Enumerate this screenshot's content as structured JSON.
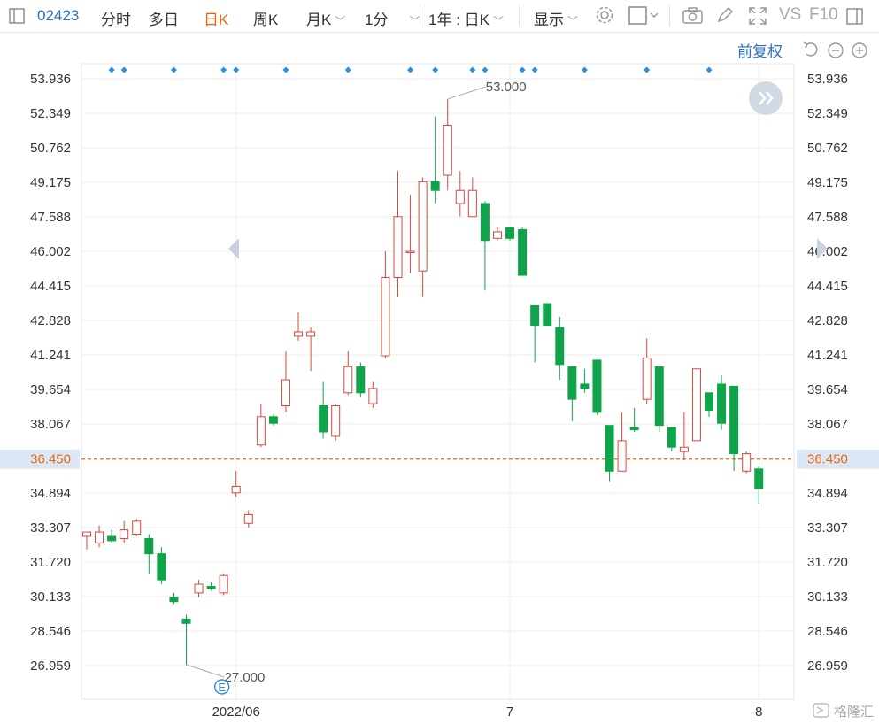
{
  "toolbar": {
    "symbol": "02423",
    "tabs": [
      "分时",
      "多日",
      "日K",
      "周K",
      "月K",
      "1分"
    ],
    "active_tab": "日K",
    "range_select": "1年 : 日K",
    "display_label": "显示",
    "vs_label": "VS",
    "f10_label": "F10"
  },
  "subbar": {
    "adjust_label": "前复权"
  },
  "watermark": "格隆汇",
  "colors": {
    "up": "#d9473c",
    "down": "#0fa44a",
    "accent": "#2a6fc0",
    "active_tab": "#e8670d",
    "current_price": "#e8670d"
  },
  "chart_data": {
    "type": "candlestick",
    "yticks": [
      53.936,
      52.349,
      50.762,
      49.175,
      47.588,
      46.002,
      44.415,
      42.828,
      41.241,
      39.654,
      38.067,
      36.45,
      34.894,
      33.307,
      31.72,
      30.133,
      28.546,
      26.959
    ],
    "ylim": [
      25.9,
      55.6
    ],
    "current_price": 36.45,
    "x_labels": [
      {
        "label": "2022/06",
        "index": 12
      },
      {
        "label": "7",
        "index": 34
      },
      {
        "label": "8",
        "index": 54
      }
    ],
    "annotations": [
      {
        "text": "53.000",
        "index": 29,
        "value": 53.0
      },
      {
        "text": "27.000",
        "index": 8,
        "value": 27.0
      }
    ],
    "event_marker": {
      "text": "E",
      "index": 11
    },
    "dividend_marks": [
      2,
      3,
      7,
      11,
      12,
      16,
      21,
      26,
      28,
      31,
      32,
      35,
      36,
      40,
      45,
      50
    ],
    "candles": [
      {
        "o": 32.9,
        "h": 33.1,
        "l": 32.3,
        "c": 33.1
      },
      {
        "o": 32.6,
        "h": 33.4,
        "l": 32.4,
        "c": 33.1
      },
      {
        "o": 32.9,
        "h": 33.2,
        "l": 32.6,
        "c": 32.7
      },
      {
        "o": 32.8,
        "h": 33.6,
        "l": 32.6,
        "c": 33.2
      },
      {
        "o": 33.0,
        "h": 33.7,
        "l": 32.9,
        "c": 33.6
      },
      {
        "o": 32.8,
        "h": 33.0,
        "l": 31.2,
        "c": 32.1
      },
      {
        "o": 32.1,
        "h": 32.4,
        "l": 30.7,
        "c": 30.9
      },
      {
        "o": 30.1,
        "h": 30.3,
        "l": 29.8,
        "c": 29.9
      },
      {
        "o": 29.1,
        "h": 29.3,
        "l": 27.0,
        "c": 28.9
      },
      {
        "o": 30.3,
        "h": 30.9,
        "l": 30.1,
        "c": 30.7
      },
      {
        "o": 30.6,
        "h": 30.8,
        "l": 30.4,
        "c": 30.5
      },
      {
        "o": 30.3,
        "h": 31.2,
        "l": 30.2,
        "c": 31.1
      },
      {
        "o": 34.9,
        "h": 35.9,
        "l": 34.7,
        "c": 35.2
      },
      {
        "o": 33.5,
        "h": 34.1,
        "l": 33.3,
        "c": 33.9
      },
      {
        "o": 37.1,
        "h": 39.0,
        "l": 37.0,
        "c": 38.4
      },
      {
        "o": 38.4,
        "h": 38.5,
        "l": 38.0,
        "c": 38.1
      },
      {
        "o": 38.9,
        "h": 41.4,
        "l": 38.6,
        "c": 40.1
      },
      {
        "o": 42.1,
        "h": 43.2,
        "l": 41.9,
        "c": 42.3
      },
      {
        "o": 42.1,
        "h": 42.5,
        "l": 40.5,
        "c": 42.3
      },
      {
        "o": 38.9,
        "h": 40.0,
        "l": 37.4,
        "c": 37.7
      },
      {
        "o": 37.5,
        "h": 39.0,
        "l": 37.3,
        "c": 38.9
      },
      {
        "o": 39.5,
        "h": 41.4,
        "l": 39.4,
        "c": 40.7
      },
      {
        "o": 40.7,
        "h": 40.9,
        "l": 39.3,
        "c": 39.5
      },
      {
        "o": 39.0,
        "h": 40.0,
        "l": 38.8,
        "c": 39.7
      },
      {
        "o": 41.2,
        "h": 46.0,
        "l": 41.1,
        "c": 44.8
      },
      {
        "o": 44.8,
        "h": 49.7,
        "l": 43.9,
        "c": 47.6
      },
      {
        "o": 46.0,
        "h": 48.6,
        "l": 45.0,
        "c": 46.0
      },
      {
        "o": 45.1,
        "h": 49.4,
        "l": 43.9,
        "c": 49.2
      },
      {
        "o": 49.2,
        "h": 52.2,
        "l": 48.2,
        "c": 48.8
      },
      {
        "o": 49.5,
        "h": 53.0,
        "l": 48.8,
        "c": 51.8
      },
      {
        "o": 48.2,
        "h": 49.7,
        "l": 47.6,
        "c": 48.8
      },
      {
        "o": 47.6,
        "h": 49.4,
        "l": 47.6,
        "c": 48.8
      },
      {
        "o": 48.2,
        "h": 48.3,
        "l": 44.2,
        "c": 46.5
      },
      {
        "o": 46.6,
        "h": 47.1,
        "l": 46.5,
        "c": 46.9
      },
      {
        "o": 47.1,
        "h": 47.1,
        "l": 46.5,
        "c": 46.6
      },
      {
        "o": 47.0,
        "h": 47.1,
        "l": 44.9,
        "c": 44.9
      },
      {
        "o": 43.5,
        "h": 43.5,
        "l": 40.9,
        "c": 42.6
      },
      {
        "o": 43.6,
        "h": 43.6,
        "l": 42.6,
        "c": 42.6
      },
      {
        "o": 42.5,
        "h": 43.0,
        "l": 40.1,
        "c": 40.8
      },
      {
        "o": 40.7,
        "h": 40.7,
        "l": 38.2,
        "c": 39.2
      },
      {
        "o": 39.9,
        "h": 40.6,
        "l": 39.5,
        "c": 39.7
      },
      {
        "o": 41.0,
        "h": 41.0,
        "l": 38.5,
        "c": 38.6
      },
      {
        "o": 38.0,
        "h": 38.0,
        "l": 35.4,
        "c": 35.9
      },
      {
        "o": 35.9,
        "h": 38.6,
        "l": 35.9,
        "c": 37.3
      },
      {
        "o": 37.9,
        "h": 38.8,
        "l": 37.7,
        "c": 37.8
      },
      {
        "o": 39.2,
        "h": 42.0,
        "l": 39.0,
        "c": 41.1
      },
      {
        "o": 40.7,
        "h": 40.7,
        "l": 37.7,
        "c": 38.0
      },
      {
        "o": 37.9,
        "h": 37.9,
        "l": 36.8,
        "c": 37.0
      },
      {
        "o": 36.8,
        "h": 38.6,
        "l": 36.4,
        "c": 37.0
      },
      {
        "o": 37.3,
        "h": 40.6,
        "l": 37.3,
        "c": 40.6
      },
      {
        "o": 39.5,
        "h": 39.5,
        "l": 38.4,
        "c": 38.7
      },
      {
        "o": 39.9,
        "h": 40.3,
        "l": 37.8,
        "c": 38.1
      },
      {
        "o": 39.8,
        "h": 39.8,
        "l": 35.9,
        "c": 36.7
      },
      {
        "o": 35.9,
        "h": 36.8,
        "l": 35.8,
        "c": 36.7
      },
      {
        "o": 36.0,
        "h": 36.1,
        "l": 34.4,
        "c": 35.1
      }
    ]
  }
}
